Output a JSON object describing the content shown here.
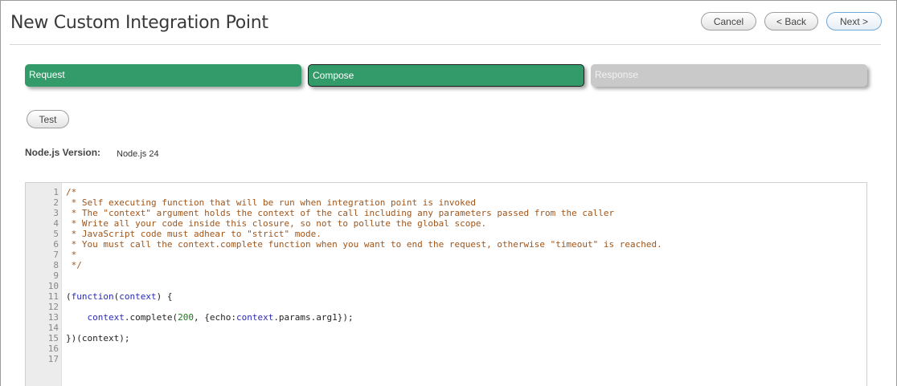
{
  "header": {
    "title": "New Custom Integration Point",
    "cancel_label": "Cancel",
    "back_label": "< Back",
    "next_label": "Next >"
  },
  "steps": [
    {
      "label": "Request",
      "state": "done"
    },
    {
      "label": "Compose",
      "state": "active"
    },
    {
      "label": "Response",
      "state": "pending"
    }
  ],
  "colors": {
    "step_active": "#339b6a",
    "step_pending": "#c9c9c9",
    "comment": "#a0551a"
  },
  "test_label": "Test",
  "runtime": {
    "label": "Node.js Version:",
    "value": "Node.js 24"
  },
  "editor": {
    "lines": [
      {
        "n": "1",
        "segments": [
          {
            "t": "/*",
            "k": "comment"
          }
        ]
      },
      {
        "n": "2",
        "segments": [
          {
            "t": " * Self executing function that will be run when integration point is invoked",
            "k": "comment"
          }
        ]
      },
      {
        "n": "3",
        "segments": [
          {
            "t": " * The \"context\" argument holds the context of the call including any parameters passed from the caller",
            "k": "comment"
          }
        ]
      },
      {
        "n": "4",
        "segments": [
          {
            "t": " * Write all your code inside this closure, so not to pollute the global scope.",
            "k": "comment"
          }
        ]
      },
      {
        "n": "5",
        "segments": [
          {
            "t": " * JavaScript code must adhear to \"strict\" mode.",
            "k": "comment"
          }
        ]
      },
      {
        "n": "6",
        "segments": [
          {
            "t": " * You must call the context.complete function when you want to end the request, otherwise \"timeout\" is reached.",
            "k": "comment"
          }
        ]
      },
      {
        "n": "7",
        "segments": [
          {
            "t": " *",
            "k": "comment"
          }
        ]
      },
      {
        "n": "8",
        "segments": [
          {
            "t": " */",
            "k": "comment"
          }
        ]
      },
      {
        "n": "9",
        "segments": []
      },
      {
        "n": "10",
        "segments": []
      },
      {
        "n": "11",
        "segments": [
          {
            "t": "(",
            "k": "plain"
          },
          {
            "t": "function",
            "k": "kw"
          },
          {
            "t": "(",
            "k": "plain"
          },
          {
            "t": "context",
            "k": "kw"
          },
          {
            "t": ") {",
            "k": "plain"
          }
        ]
      },
      {
        "n": "12",
        "segments": []
      },
      {
        "n": "13",
        "segments": [
          {
            "t": "    ",
            "k": "plain"
          },
          {
            "t": "context",
            "k": "kw"
          },
          {
            "t": ".complete(",
            "k": "plain"
          },
          {
            "t": "200",
            "k": "num"
          },
          {
            "t": ", {echo:",
            "k": "plain"
          },
          {
            "t": "context",
            "k": "kw"
          },
          {
            "t": ".params.arg1});",
            "k": "plain"
          }
        ]
      },
      {
        "n": "14",
        "segments": []
      },
      {
        "n": "15",
        "segments": [
          {
            "t": "})(context);",
            "k": "plain"
          }
        ]
      },
      {
        "n": "16",
        "segments": []
      },
      {
        "n": "17",
        "segments": []
      }
    ]
  }
}
